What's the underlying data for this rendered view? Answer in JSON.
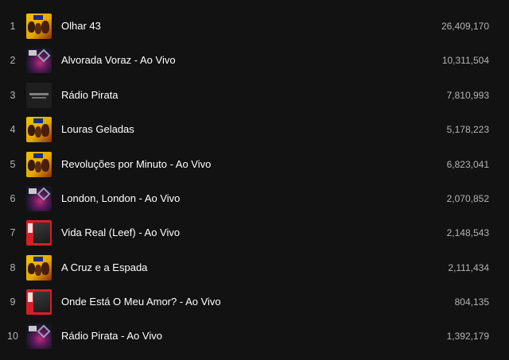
{
  "tracks": [
    {
      "number": "1",
      "title": "Olhar 43",
      "plays": "26,409,170",
      "cover_icon": "album-cover-yellow"
    },
    {
      "number": "2",
      "title": "Alvorada Voraz - Ao Vivo",
      "plays": "10,311,504",
      "cover_icon": "album-cover-dark"
    },
    {
      "number": "3",
      "title": "Rádio Pirata",
      "plays": "7,810,993",
      "cover_icon": "album-cover-black"
    },
    {
      "number": "4",
      "title": "Louras Geladas",
      "plays": "5,178,223",
      "cover_icon": "album-cover-yellow"
    },
    {
      "number": "5",
      "title": "Revoluções por Minuto - Ao Vivo",
      "plays": "6,823,041",
      "cover_icon": "album-cover-yellow"
    },
    {
      "number": "6",
      "title": "London, London - Ao Vivo",
      "plays": "2,070,852",
      "cover_icon": "album-cover-dark"
    },
    {
      "number": "7",
      "title": "Vida Real (Leef) - Ao Vivo",
      "plays": "2,148,543",
      "cover_icon": "album-cover-red"
    },
    {
      "number": "8",
      "title": "A Cruz e a Espada",
      "plays": "2,111,434",
      "cover_icon": "album-cover-yellow"
    },
    {
      "number": "9",
      "title": "Onde Está O Meu Amor? - Ao Vivo",
      "plays": "804,135",
      "cover_icon": "album-cover-red"
    },
    {
      "number": "10",
      "title": "Rádio Pirata - Ao Vivo",
      "plays": "1,392,179",
      "cover_icon": "album-cover-dark"
    }
  ],
  "colors": {
    "background": "#121212",
    "title_text": "#ffffff",
    "secondary_text": "#b3b3b3"
  }
}
